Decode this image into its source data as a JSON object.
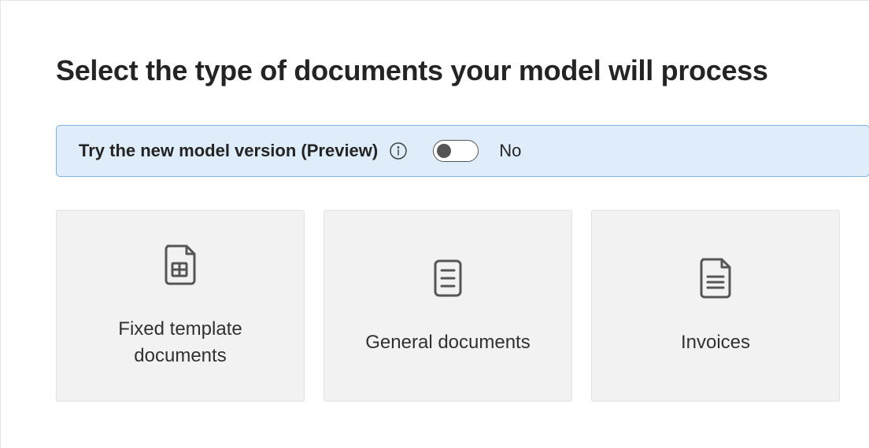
{
  "title": "Select the type of documents your model will process",
  "preview_banner": {
    "label": "Try the new model version (Preview)",
    "toggle_state": "No"
  },
  "cards": [
    {
      "label": "Fixed template documents"
    },
    {
      "label": "General documents"
    },
    {
      "label": "Invoices"
    }
  ]
}
